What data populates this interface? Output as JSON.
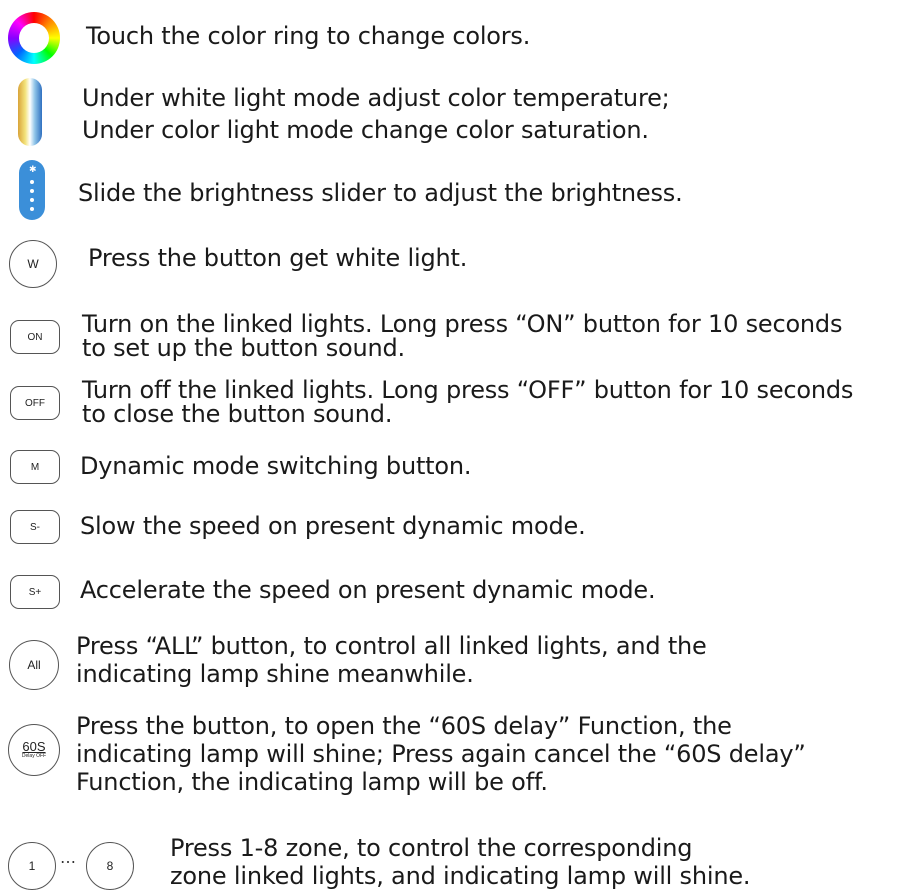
{
  "rows": [
    {
      "id": "color-ring",
      "lines": [
        "Touch the color ring to change colors."
      ]
    },
    {
      "id": "temperature",
      "lines": [
        "Under white light mode adjust color temperature;",
        "Under color light mode change color saturation."
      ]
    },
    {
      "id": "brightness",
      "lines": [
        "Slide the brightness slider to adjust the brightness."
      ]
    },
    {
      "id": "white",
      "lines": [
        "Press the button get white light."
      ],
      "button": "W"
    },
    {
      "id": "on",
      "lines": [
        "Turn on the linked lights. Long press “ON” button for 10 seconds",
        "to set up the button sound."
      ],
      "button": "ON"
    },
    {
      "id": "off",
      "lines": [
        "Turn off the linked lights. Long press “OFF” button for 10 seconds",
        "to close the button sound."
      ],
      "button": "OFF"
    },
    {
      "id": "mode",
      "lines": [
        "Dynamic mode switching button."
      ],
      "button": "M"
    },
    {
      "id": "slow",
      "lines": [
        "Slow the speed on present dynamic mode."
      ],
      "button": "S-"
    },
    {
      "id": "fast",
      "lines": [
        "Accelerate the speed on present dynamic mode."
      ],
      "button": "S+"
    },
    {
      "id": "all",
      "lines": [
        "Press “ALL” button, to control all linked lights, and the",
        "indicating lamp shine meanwhile."
      ],
      "button": "All"
    },
    {
      "id": "delay",
      "lines": [
        "Press the button, to open the “60S delay” Function, the",
        "indicating lamp will shine; Press again cancel the “60S delay”",
        "Function, the indicating lamp will be off."
      ],
      "button": "60S",
      "button_sub": "Delay OFF"
    },
    {
      "id": "zones",
      "lines": [
        "Press 1-8 zone, to control the corresponding",
        "zone linked lights, and indicating lamp will shine."
      ],
      "button_first": "1",
      "ellipsis": "…",
      "button_last": "8"
    }
  ],
  "colors": {
    "ring": [
      "#ff0000",
      "#ffff00",
      "#00ff00",
      "#00ffff",
      "#0000ff",
      "#ff00ff"
    ],
    "slider_blue": "#3b8fd9",
    "button_border": "#555555"
  }
}
